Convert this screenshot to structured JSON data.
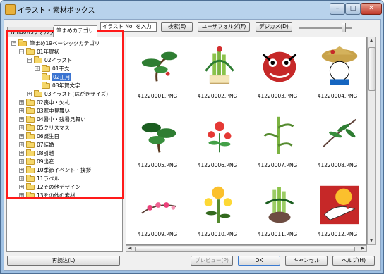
{
  "window": {
    "title": "イラスト・素材ボックス",
    "min_icon": "minimize-icon",
    "max_icon": "maximize-icon",
    "close_icon": "close-icon",
    "min_glyph": "–",
    "max_glyph": "□",
    "close_glyph": "✕"
  },
  "tabs": [
    {
      "label": "Windowsフォルダ"
    },
    {
      "label": "筆まめカテゴリ"
    }
  ],
  "toolbar": {
    "search_input_value": "イラスト No. を入力",
    "search_button": "検索(E)",
    "user_folder_button": "ユーザフォルダ(F)",
    "digicam_button": "デジカメ(D)",
    "slider_level": 0.85
  },
  "tree": {
    "root": "筆まめ19ベーシックカテゴリ",
    "items": [
      {
        "label": "01年賀状",
        "expander": "−"
      },
      {
        "label": "02イラスト",
        "expander": "−"
      },
      {
        "label": "01干支",
        "expander": "+"
      },
      {
        "label": "02正月",
        "expander": ""
      },
      {
        "label": "03年賀文字",
        "expander": ""
      },
      {
        "label": "03イラスト(はがきサイズ)",
        "expander": "+"
      },
      {
        "label": "02喪中・欠礼",
        "expander": "+"
      },
      {
        "label": "03寒中見舞い",
        "expander": "+"
      },
      {
        "label": "04暑中・残暑見舞い",
        "expander": "+"
      },
      {
        "label": "05クリスマス",
        "expander": "+"
      },
      {
        "label": "06誕生日",
        "expander": "+"
      },
      {
        "label": "07結婚",
        "expander": "+"
      },
      {
        "label": "08引越",
        "expander": "+"
      },
      {
        "label": "09出産",
        "expander": "+"
      },
      {
        "label": "10季節イベント・挨拶",
        "expander": "+"
      },
      {
        "label": "11ラベル",
        "expander": "+"
      },
      {
        "label": "12その他デザイン",
        "expander": "+"
      },
      {
        "label": "13その他の素材",
        "expander": "+"
      }
    ],
    "root_expander": "−",
    "selected": "02正月"
  },
  "thumbnails": [
    {
      "file": "41220001.PNG",
      "icon": "pine-tree-icon"
    },
    {
      "file": "41220002.PNG",
      "icon": "kadomatsu-icon"
    },
    {
      "file": "41220003.PNG",
      "icon": "shishi-mask-icon"
    },
    {
      "file": "41220004.PNG",
      "icon": "daruma-hat-icon"
    },
    {
      "file": "41220005.PNG",
      "icon": "bonsai-pine-icon"
    },
    {
      "file": "41220006.PNG",
      "icon": "red-flower-icon"
    },
    {
      "file": "41220007.PNG",
      "icon": "bamboo-icon"
    },
    {
      "file": "41220008.PNG",
      "icon": "bamboo-leaf-icon"
    },
    {
      "file": "41220009.PNG",
      "icon": "plum-blossom-icon"
    },
    {
      "file": "41220010.PNG",
      "icon": "chrysanthemum-icon"
    },
    {
      "file": "41220011.PNG",
      "icon": "kadomatsu-bamboo-icon"
    },
    {
      "file": "41220012.PNG",
      "icon": "crane-icon"
    }
  ],
  "buttons": {
    "reload": "再読込(L)",
    "preview": "プレビュー(P)",
    "ok": "OK",
    "cancel": "キャンセル",
    "help": "ヘルプ(H)"
  },
  "colors": {
    "highlight_box": "#ff1a1a",
    "selection": "#3b74d1"
  }
}
